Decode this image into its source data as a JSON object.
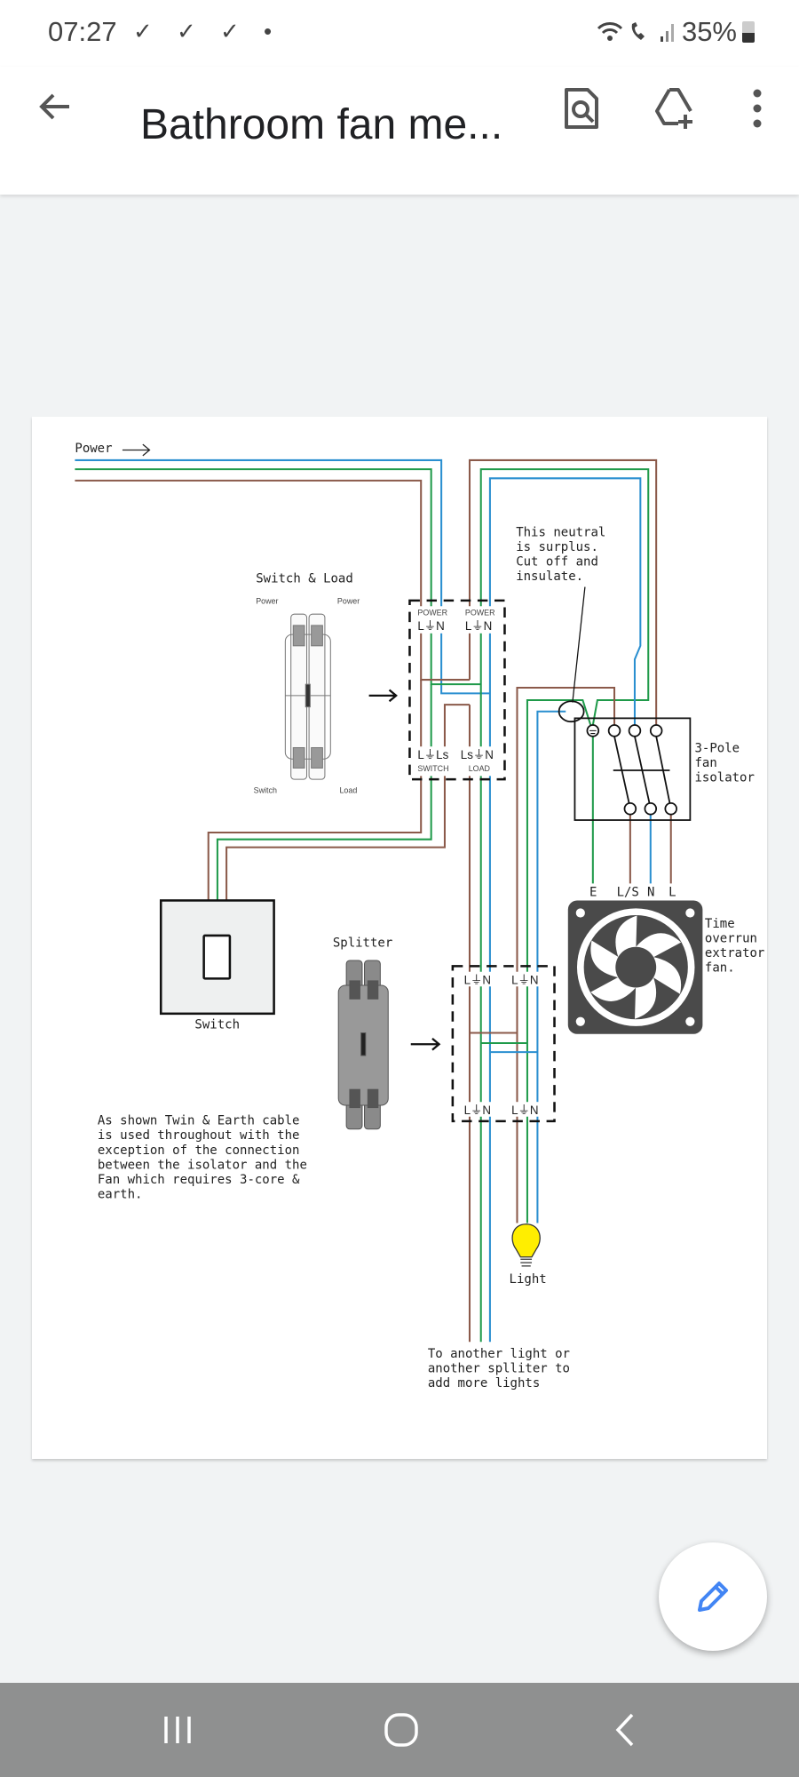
{
  "status_bar": {
    "time": "07:27",
    "notifications": "✓ ✓ ✓ •",
    "battery": "35%",
    "icons": [
      "wifi-icon",
      "wifi-calling-icon",
      "signal-icon",
      "battery-icon"
    ]
  },
  "app_bar": {
    "title": "Bathroom fan me...",
    "back_icon": "arrow-left-icon",
    "actions": [
      "find-in-document-icon",
      "add-to-drive-icon",
      "more-vert-icon"
    ]
  },
  "diagram": {
    "power_label": "Power",
    "switch_load_title": "Switch & Load",
    "connector_labels": {
      "power_left": "Power",
      "power_right": "Power",
      "switch": "Switch",
      "load": "Load"
    },
    "box1": {
      "top_left_header": "POWER",
      "top_left_terms": "L⏚N",
      "top_right_header": "POWER",
      "top_right_terms": "L⏚N",
      "bottom_left_terms": "L⏚Ls",
      "bottom_left_footer": "SWITCH",
      "bottom_right_terms": "Ls⏚N",
      "bottom_right_footer": "LOAD"
    },
    "callout": [
      "This neutral",
      "is surplus.",
      "Cut off and",
      "insulate."
    ],
    "isolator_label": [
      "3-Pole",
      "fan",
      "isolator"
    ],
    "fan_terminals": [
      "E",
      "L/S",
      "N",
      "L"
    ],
    "fan_label": [
      "Time",
      "overrun",
      "extrator",
      "fan."
    ],
    "switch_label": "Switch",
    "splitter_title": "Splitter",
    "splitter_terms": {
      "top_left": "L⏚N",
      "top_right": "L⏚N",
      "bottom_left": "L⏚N",
      "bottom_right": "L⏚N"
    },
    "note": [
      "As shown Twin & Earth cable",
      "is used throughout with the",
      "exception of the connection",
      "between the isolator and the",
      "Fan which requires 3-core &",
      "earth."
    ],
    "light_label": "Light",
    "continuation": [
      "To another light or",
      "another splliter to",
      "add more lights"
    ],
    "colors": {
      "live": "#8b5a4a",
      "earth": "#1f9a4a",
      "neutral": "#2a8fd0",
      "bulb": "#ffee00",
      "fan": "#4a4a4a"
    }
  },
  "fab": {
    "icon": "edit-pencil-icon",
    "color": "#4285f4"
  },
  "nav_bar": {
    "icons": [
      "recent-apps-icon",
      "home-icon",
      "back-icon"
    ]
  }
}
